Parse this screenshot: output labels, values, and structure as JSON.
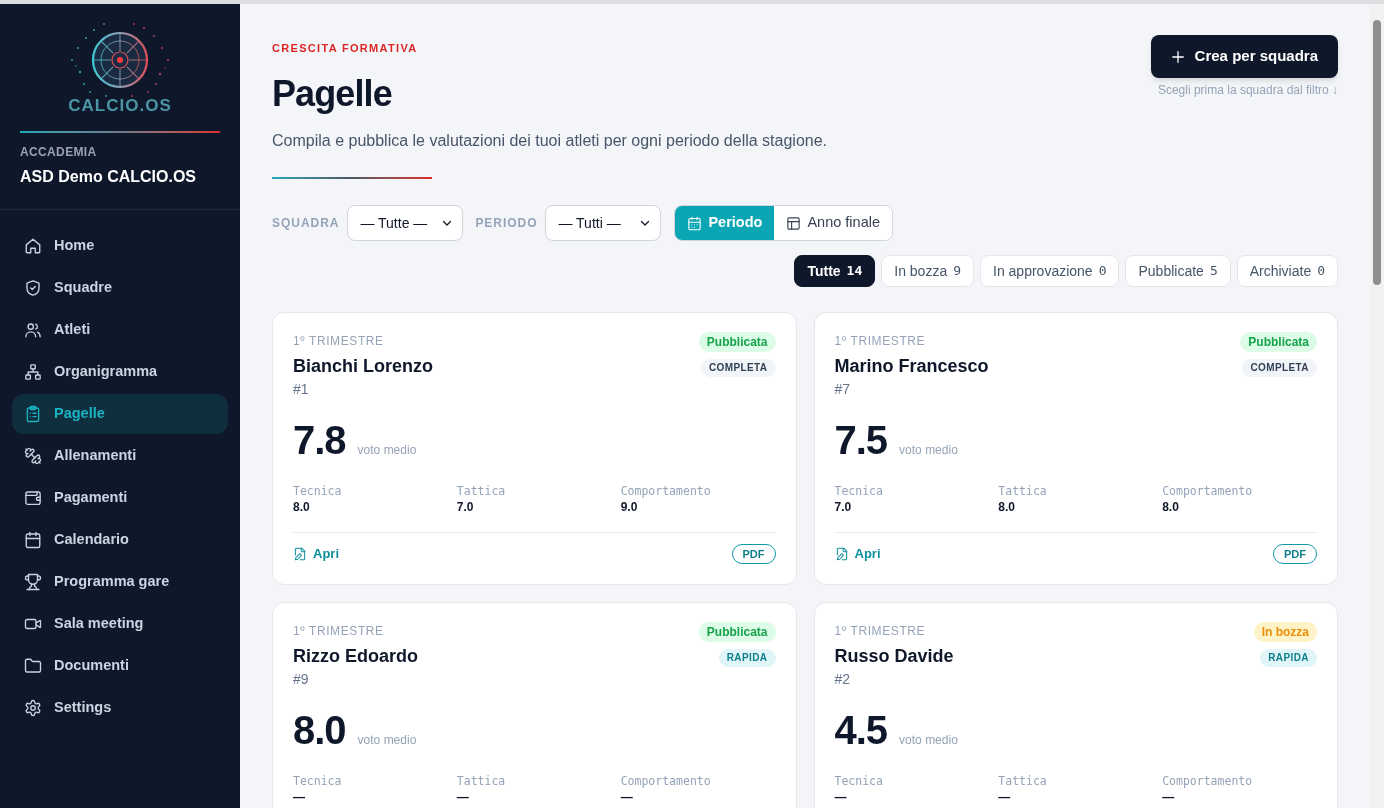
{
  "sidebar": {
    "logo_text": "CALCIO.OS",
    "org_label": "ACCADEMIA",
    "org_name": "ASD Demo CALCIO.OS",
    "items": [
      {
        "label": "Home",
        "selected": false
      },
      {
        "label": "Squadre",
        "selected": false
      },
      {
        "label": "Atleti",
        "selected": false
      },
      {
        "label": "Organigramma",
        "selected": false
      },
      {
        "label": "Pagelle",
        "selected": true
      },
      {
        "label": "Allenamenti",
        "selected": false
      },
      {
        "label": "Pagamenti",
        "selected": false
      },
      {
        "label": "Calendario",
        "selected": false
      },
      {
        "label": "Programma gare",
        "selected": false
      },
      {
        "label": "Sala meeting",
        "selected": false
      },
      {
        "label": "Documenti",
        "selected": false
      },
      {
        "label": "Settings",
        "selected": false
      }
    ]
  },
  "header": {
    "eyebrow": "CRESCITA FORMATIVA",
    "title": "Pagelle",
    "description": "Compila e pubblica le valutazioni dei tuoi atleti per ogni periodo della stagione.",
    "create_button": "Crea per squadra",
    "create_hint": "Scegli prima la squadra dal filtro ↓"
  },
  "filters": {
    "team_label": "SQUADRA",
    "team_value": "— Tutte —",
    "period_label": "PERIODO",
    "period_value": "— Tutti —",
    "view_modes": [
      {
        "label": "Periodo",
        "selected": true
      },
      {
        "label": "Anno finale",
        "selected": false
      }
    ]
  },
  "status_tabs": [
    {
      "label": "Tutte",
      "count": "14",
      "selected": true
    },
    {
      "label": "In bozza",
      "count": "9",
      "selected": false
    },
    {
      "label": "In approvazione",
      "count": "0",
      "selected": false
    },
    {
      "label": "Pubblicate",
      "count": "5",
      "selected": false
    },
    {
      "label": "Archiviate",
      "count": "0",
      "selected": false
    }
  ],
  "cards": [
    {
      "period": "1º TRIMESTRE",
      "name": "Bianchi Lorenzo",
      "number": "#1",
      "status": {
        "label": "Pubblicata",
        "kind": "published"
      },
      "type": {
        "label": "COMPLETA",
        "kind": "full"
      },
      "average": "7.8",
      "average_label": "voto medio",
      "metrics": [
        {
          "label": "Tecnica",
          "value": "8.0"
        },
        {
          "label": "Tattica",
          "value": "7.0"
        },
        {
          "label": "Comportamento",
          "value": "9.0"
        }
      ],
      "footer": {
        "open_label": "Apri",
        "pdf_label": "PDF"
      }
    },
    {
      "period": "1º TRIMESTRE",
      "name": "Marino Francesco",
      "number": "#7",
      "status": {
        "label": "Pubblicata",
        "kind": "published"
      },
      "type": {
        "label": "COMPLETA",
        "kind": "full"
      },
      "average": "7.5",
      "average_label": "voto medio",
      "metrics": [
        {
          "label": "Tecnica",
          "value": "7.0"
        },
        {
          "label": "Tattica",
          "value": "8.0"
        },
        {
          "label": "Comportamento",
          "value": "8.0"
        }
      ],
      "footer": {
        "open_label": "Apri",
        "pdf_label": "PDF"
      }
    },
    {
      "period": "1º TRIMESTRE",
      "name": "Rizzo Edoardo",
      "number": "#9",
      "status": {
        "label": "Pubblicata",
        "kind": "published"
      },
      "type": {
        "label": "RAPIDA",
        "kind": "quick"
      },
      "average": "8.0",
      "average_label": "voto medio",
      "metrics": [
        {
          "label": "Tecnica",
          "value": "—"
        },
        {
          "label": "Tattica",
          "value": "—"
        },
        {
          "label": "Comportamento",
          "value": "—"
        }
      ]
    },
    {
      "period": "1º TRIMESTRE",
      "name": "Russo Davide",
      "number": "#2",
      "status": {
        "label": "In bozza",
        "kind": "draft"
      },
      "type": {
        "label": "RAPIDA",
        "kind": "quick"
      },
      "average": "4.5",
      "average_label": "voto medio",
      "metrics": [
        {
          "label": "Tecnica",
          "value": "—"
        },
        {
          "label": "Tattica",
          "value": "—"
        },
        {
          "label": "Comportamento",
          "value": "—"
        }
      ]
    }
  ]
}
